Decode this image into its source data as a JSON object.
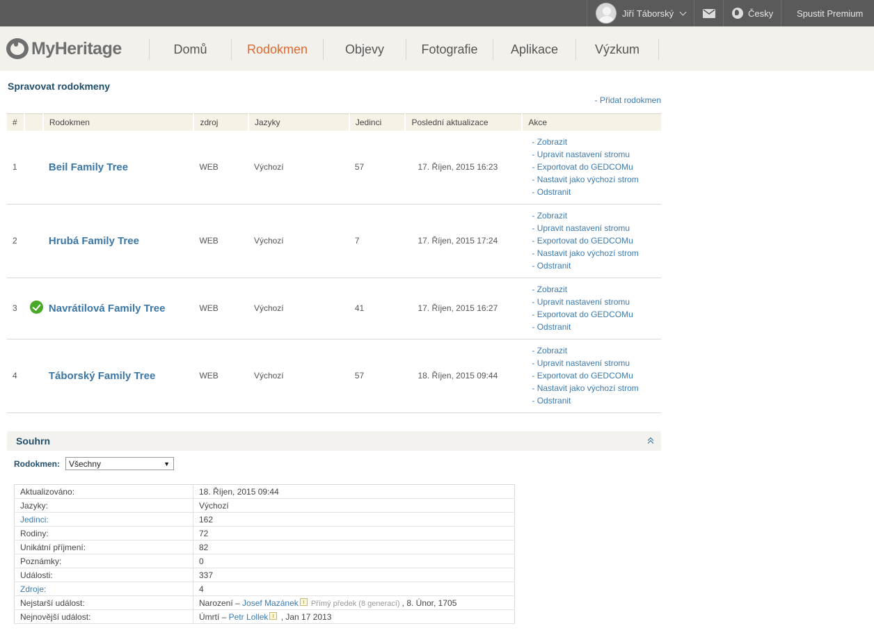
{
  "topbar": {
    "user_name": "Jiří Táborský",
    "language": "Česky",
    "premium": "Spustit Premium"
  },
  "brand": {
    "logo_text": "MyHeritage"
  },
  "nav": {
    "items": [
      "Domů",
      "Rodokmen",
      "Objevy",
      "Fotografie",
      "Aplikace",
      "Výzkum"
    ],
    "active": "Rodokmen"
  },
  "page": {
    "title": "Spravovat rodokmeny",
    "add_tree": "- Přidat rodokmen"
  },
  "trees_table": {
    "headers": [
      "#",
      "",
      "Rodokmen",
      "zdroj",
      "Jazyky",
      "Jedinci",
      "Poslední aktualizace",
      "Akce"
    ],
    "rows": [
      {
        "num": "1",
        "default": false,
        "name": "Beil Family Tree",
        "source": "WEB",
        "lang": "Výchozí",
        "people": "57",
        "updated": "17. Říjen, 2015 16:23",
        "actions": [
          "- Zobrazit",
          "- Upravit nastavení stromu",
          "- Exportovat do GEDCOMu",
          "- Nastavit jako výchozí strom",
          "- Odstranit"
        ]
      },
      {
        "num": "2",
        "default": false,
        "name": "Hrubá Family Tree",
        "source": "WEB",
        "lang": "Výchozí",
        "people": "7",
        "updated": "17. Říjen, 2015 17:24",
        "actions": [
          "- Zobrazit",
          "- Upravit nastavení stromu",
          "- Exportovat do GEDCOMu",
          "- Nastavit jako výchozí strom",
          "- Odstranit"
        ]
      },
      {
        "num": "3",
        "default": true,
        "name": "Navrátilová Family Tree",
        "source": "WEB",
        "lang": "Výchozí",
        "people": "41",
        "updated": "17. Říjen, 2015 16:27",
        "actions": [
          "- Zobrazit",
          "- Upravit nastavení stromu",
          "- Exportovat do GEDCOMu",
          "- Odstranit"
        ]
      },
      {
        "num": "4",
        "default": false,
        "name": "Táborský Family Tree",
        "source": "WEB",
        "lang": "Výchozí",
        "people": "57",
        "updated": "18. Říjen, 2015 09:44",
        "actions": [
          "- Zobrazit",
          "- Upravit nastavení stromu",
          "- Exportovat do GEDCOMu",
          "- Nastavit jako výchozí strom",
          "- Odstranit"
        ]
      }
    ]
  },
  "summary": {
    "title": "Souhrn",
    "filter_label": "Rodokmen:",
    "filter_value": "Všechny",
    "stats": [
      {
        "key": "Aktualizováno:",
        "value": "18. Říjen, 2015 09:44",
        "link": false
      },
      {
        "key": "Jazyky:",
        "value": "Výchozí",
        "link": false
      },
      {
        "key": "Jedinci:",
        "value": "162",
        "link": true
      },
      {
        "key": "Rodiny:",
        "value": "72",
        "link": false
      },
      {
        "key": "Unikátní příjmení:",
        "value": "82",
        "link": false
      },
      {
        "key": "Poznámky:",
        "value": "0",
        "link": false
      },
      {
        "key": "Události:",
        "value": "337",
        "link": false
      },
      {
        "key": "Zdroje:",
        "value": "4",
        "link": true
      }
    ],
    "oldest": {
      "key": "Nejstarší událost:",
      "prefix": "Narození – ",
      "person": "Josef Mazánek",
      "relation": " Přímý předek (8 generací) ",
      "suffix": ", 8. Únor, 1705"
    },
    "newest": {
      "key": "Nejnovější událost:",
      "prefix": "Úmrtí – ",
      "person": "Petr Lollek",
      "suffix": " , Jan 17 2013"
    }
  }
}
